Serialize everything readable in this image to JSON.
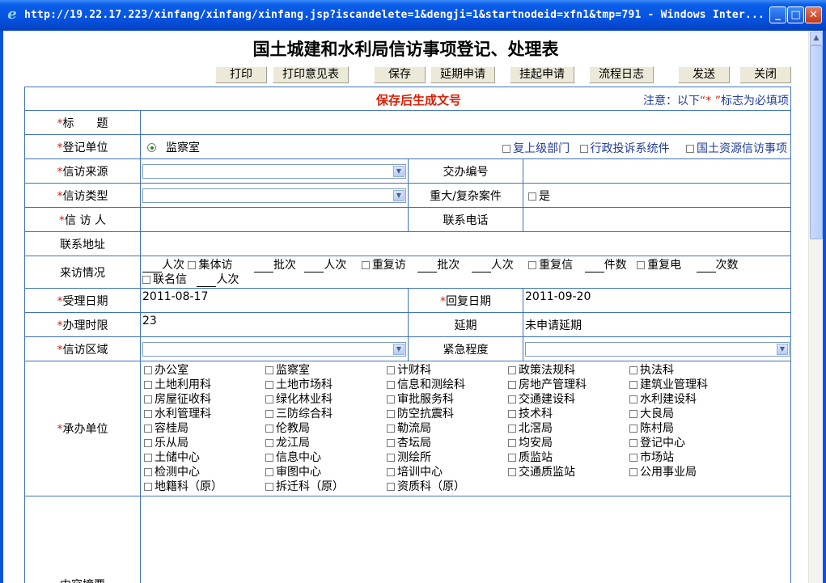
{
  "window": {
    "title": "http://19.22.17.223/xinfang/xinfang/xinfang.jsp?iscandelete=1&dengji=1&startnodeid=xfn1&tmp=791 - Windows Inter...",
    "icon": "ie-icon"
  },
  "page": {
    "title": "国土城建和水利局信访事项登记、处理表",
    "doc_number_note": "保存后生成文号",
    "notice_prefix": "注意：以下",
    "notice_star": "“* ”",
    "notice_suffix": "标志为必填项"
  },
  "toolbar": {
    "buttons": [
      "打印",
      "打印意见表",
      "保存",
      "延期申请",
      "挂起申请",
      "流程日志",
      "发送",
      "关闭"
    ]
  },
  "required_mark": "*",
  "fields": {
    "title_label": "标　　题",
    "reg_unit_label": "登记单位",
    "reg_unit_value": "监察室",
    "reg_checks": [
      "复上级部门",
      "行政投诉系统件",
      "国土资源信访事项"
    ],
    "source_label": "信访来源",
    "assign_no_label": "交办编号",
    "type_label": "信访类型",
    "major_label": "重大/复杂案件",
    "major_check": "是",
    "petitioner_label": "信 访 人",
    "phone_label": "联系电话",
    "address_label": "联系地址",
    "visit_label": "来访情况",
    "visit_items": [
      {
        "check": false,
        "text": "人次"
      },
      {
        "check": true,
        "text": "集体访"
      },
      {
        "check": false,
        "text": "批次"
      },
      {
        "check": false,
        "text": "人次"
      },
      {
        "check": true,
        "text": "重复访"
      },
      {
        "check": false,
        "text": "批次"
      },
      {
        "check": false,
        "text": "人次"
      },
      {
        "check": true,
        "text": "重复信"
      },
      {
        "check": false,
        "text": "件数"
      },
      {
        "check": true,
        "text": "重复电"
      },
      {
        "check": false,
        "text": "次数"
      }
    ],
    "visit_line2": [
      {
        "check": true,
        "text": "联名信"
      },
      {
        "check": false,
        "text": "人次"
      }
    ],
    "accept_date_label": "受理日期",
    "accept_date_value": "2011-08-17",
    "reply_date_label": "回复日期",
    "reply_date_value": "2011-09-20",
    "limit_label": "办理时限",
    "limit_value": "23",
    "extend_label": "延期",
    "extend_value": "未申请延期",
    "region_label": "信访区域",
    "urgency_label": "紧急程度",
    "units_label": "承办单位",
    "units": [
      "办公室",
      "监察室",
      "计财科",
      "政策法规科",
      "执法科",
      "土地利用科",
      "土地市场科",
      "信息和测绘科",
      "房地产管理科",
      "建筑业管理科",
      "房屋征收科",
      "绿化林业科",
      "审批服务科",
      "交通建设科",
      "水利建设科",
      "水利管理科",
      "三防综合科",
      "防空抗震科",
      "技术科",
      "大良局",
      "容桂局",
      "伦教局",
      "勒流局",
      "北滘局",
      "陈村局",
      "乐从局",
      "龙江局",
      "杏坛局",
      "均安局",
      "登记中心",
      "土储中心",
      "信息中心",
      "测绘所",
      "质监站",
      "市场站",
      "检测中心",
      "审图中心",
      "培训中心",
      "交通质监站",
      "公用事业局",
      "地籍科（原）",
      "拆迁科（原）",
      "资质科（原）"
    ],
    "summary_label": "内容摘要"
  }
}
